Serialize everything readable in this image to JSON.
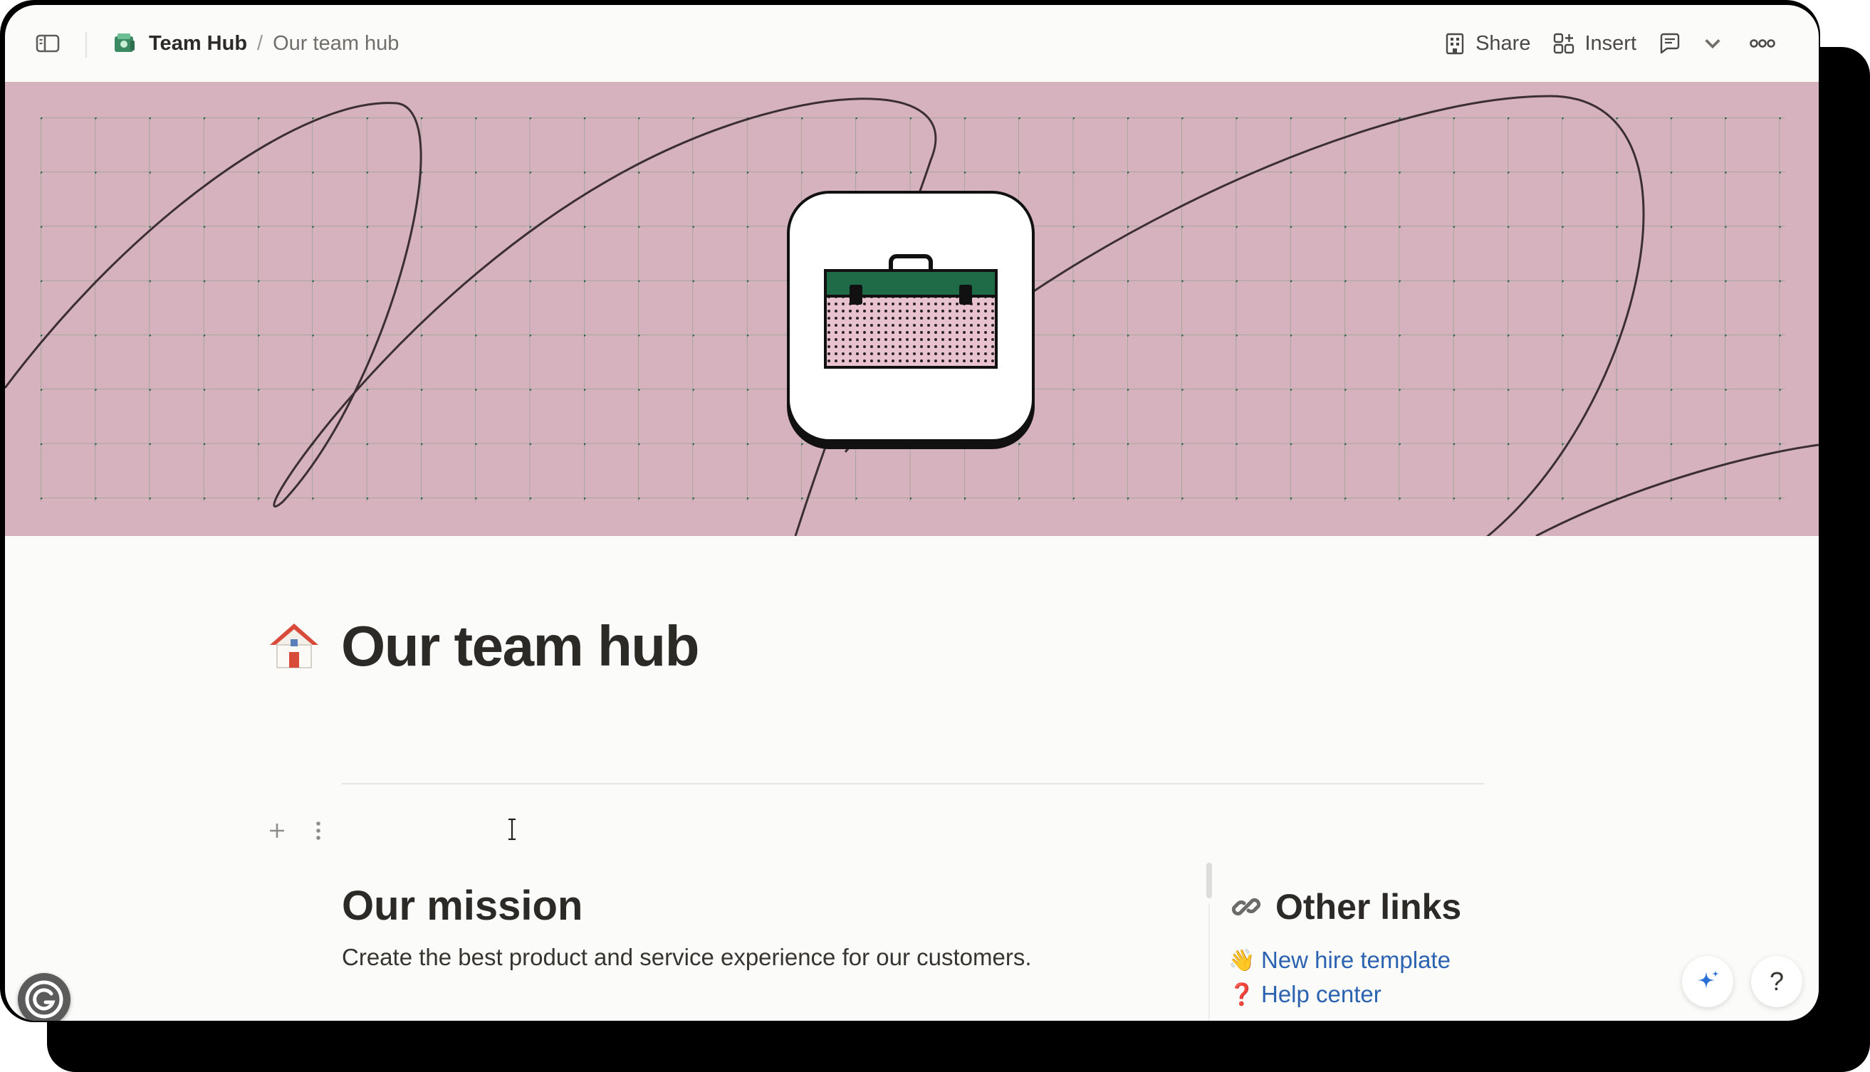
{
  "breadcrumb": {
    "workspace": "Team Hub",
    "separator": "/",
    "page": "Our team hub"
  },
  "toolbar": {
    "share_label": "Share",
    "insert_label": "Insert"
  },
  "page": {
    "title": "Our team hub",
    "icon": "house-emoji",
    "cover_icon": "toolbox-icon"
  },
  "mission": {
    "heading": "Our mission",
    "text": "Create the best product and service experience for our customers."
  },
  "other_links": {
    "heading": "Other links",
    "items": [
      {
        "emoji": "👋",
        "label": "New hire template"
      },
      {
        "emoji": "❓",
        "label": "Help center"
      }
    ]
  },
  "help_label": "?",
  "colors": {
    "cover": "#d5b2be",
    "link": "#2b63b0",
    "toolbox_green": "#1f6b48"
  }
}
